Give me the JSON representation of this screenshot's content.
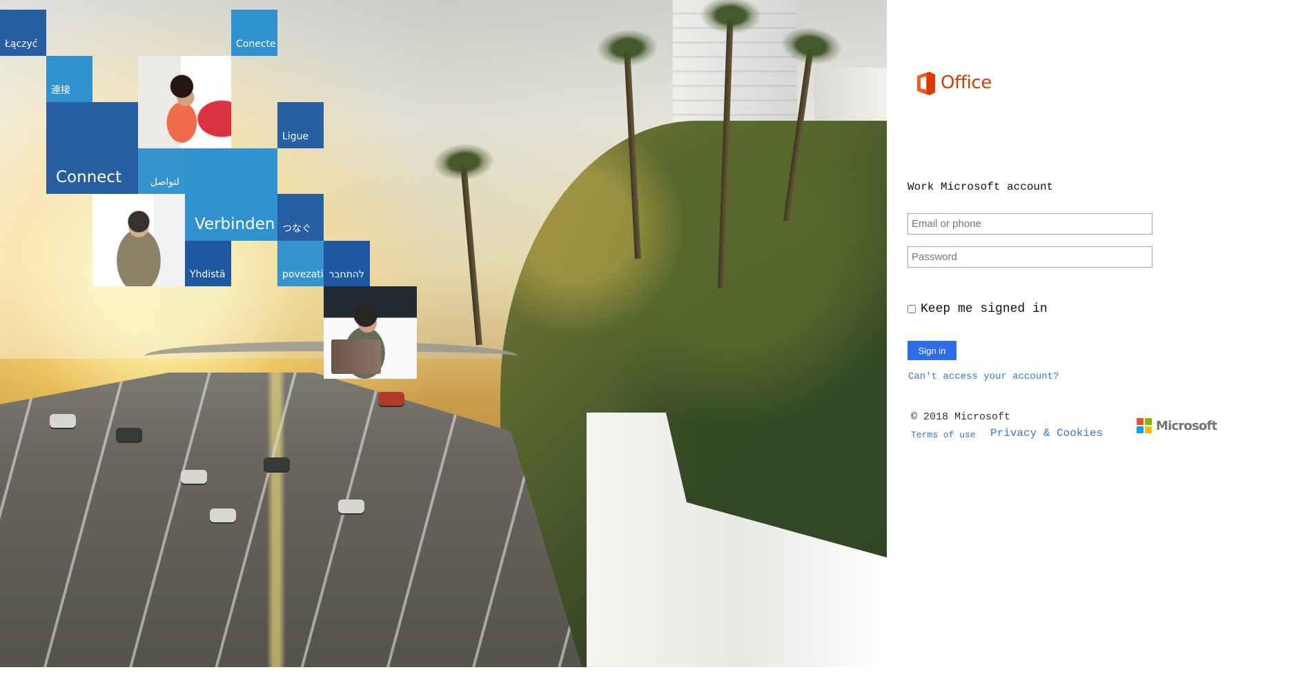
{
  "hero": {
    "tiles": [
      "Łączyć",
      "Conecte",
      "連接",
      "Ligue",
      "Connect",
      "لتواصل",
      "Verbinden",
      "つなぐ",
      "Yhdistä",
      "povezati",
      "להתחבר"
    ]
  },
  "branding": {
    "office_label": "Office",
    "microsoft_label": "Microsoft",
    "office_color": "#d83b01"
  },
  "form": {
    "account_type": "Work Microsoft account",
    "email_placeholder": "Email or phone",
    "password_placeholder": "Password",
    "keep_signed_in": "Keep me signed in",
    "sign_in": "Sign in",
    "access_help": "Can't access your account?"
  },
  "footer": {
    "copyright": "© 2018 Microsoft",
    "terms": "Terms of use",
    "privacy": "Privacy & Cookies"
  },
  "colors": {
    "sign_in_button": "#2d6ee8",
    "link": "#2f76dd",
    "tile_blue": "#285fa3",
    "tile_light_blue": "#2f91cd"
  }
}
